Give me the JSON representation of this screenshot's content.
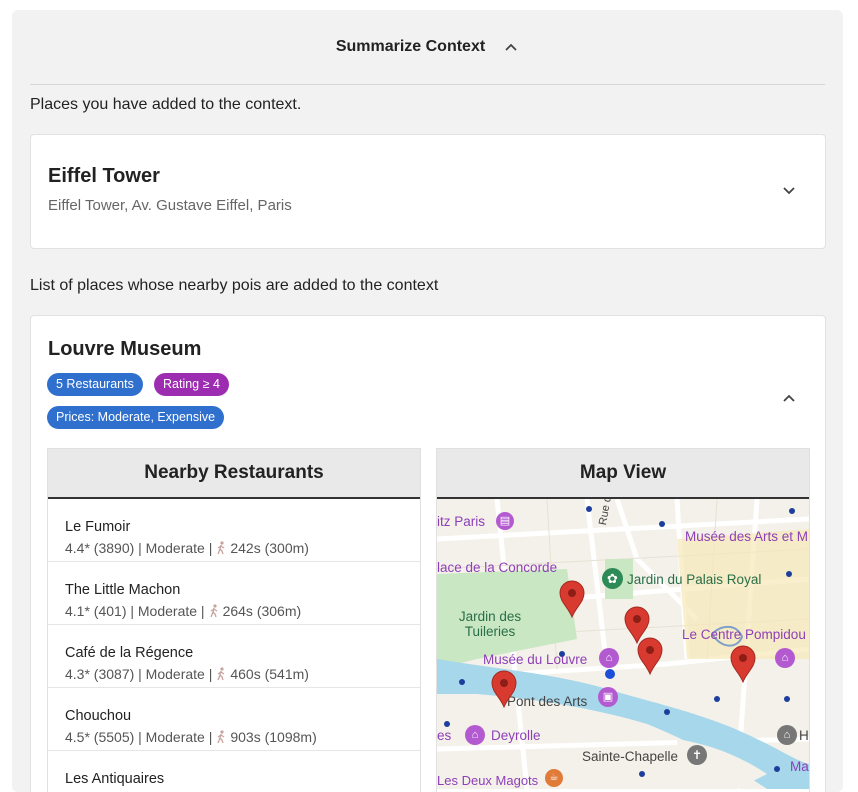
{
  "panel": {
    "title": "Summarize Context"
  },
  "added_places": {
    "label": "Places you have added to the context.",
    "items": [
      {
        "name": "Eiffel Tower",
        "address": "Eiffel Tower, Av. Gustave Eiffel, Paris"
      }
    ]
  },
  "nearby": {
    "label": "List of places whose nearby pois are added to the context",
    "place": {
      "name": "Louvre Museum",
      "chips": [
        {
          "label": "5 Restaurants",
          "color": "#2f6fce"
        },
        {
          "label": "Rating ≥ 4",
          "color": "#9c2cb0"
        },
        {
          "label": "Prices: Moderate, Expensive",
          "color": "#2f6fce"
        }
      ],
      "restaurants_title": "Nearby Restaurants",
      "restaurants": [
        {
          "name": "Le Fumoir",
          "rating": "4.4* (3890) | Moderate |",
          "walk": "242s (300m)"
        },
        {
          "name": "The Little Machon",
          "rating": "4.1* (401) | Moderate |",
          "walk": "264s (306m)"
        },
        {
          "name": "Café de la Régence",
          "rating": "4.3* (3087) | Moderate |",
          "walk": "460s (541m)"
        },
        {
          "name": "Chouchou",
          "rating": "4.5* (5505) | Moderate |",
          "walk": "903s (1098m)"
        },
        {
          "name": "Les Antiquaires",
          "rating": "",
          "walk": ""
        }
      ],
      "map_title": "Map View",
      "map_labels": {
        "ritz": "itz Paris",
        "rue_richelieu": "Rue de Richelieu",
        "musee_arts": "Musée des Arts et M",
        "concorde": "lace de la Concorde",
        "palais_royal": "Jardin du Palais Royal",
        "tuileries": "Jardin des Tuileries",
        "pompidou": "Le Centre Pompidou",
        "louvre": "Musée du Louvre",
        "pont_arts": "Pont des Arts",
        "es": "es",
        "deyrolle": "Deyrolle",
        "sainte_chapelle": "Sainte-Chapelle",
        "h": "H",
        "ma": "Ma",
        "deux_magots": "Les Deux Magots"
      }
    }
  },
  "colors": {
    "chip_blue": "#2f6fce",
    "chip_purple": "#9c2cb0",
    "map_pin": "#d93a2f",
    "map_water": "#a7d7ea",
    "map_park": "#c9e7c2",
    "map_land": "#f4f1ea"
  }
}
